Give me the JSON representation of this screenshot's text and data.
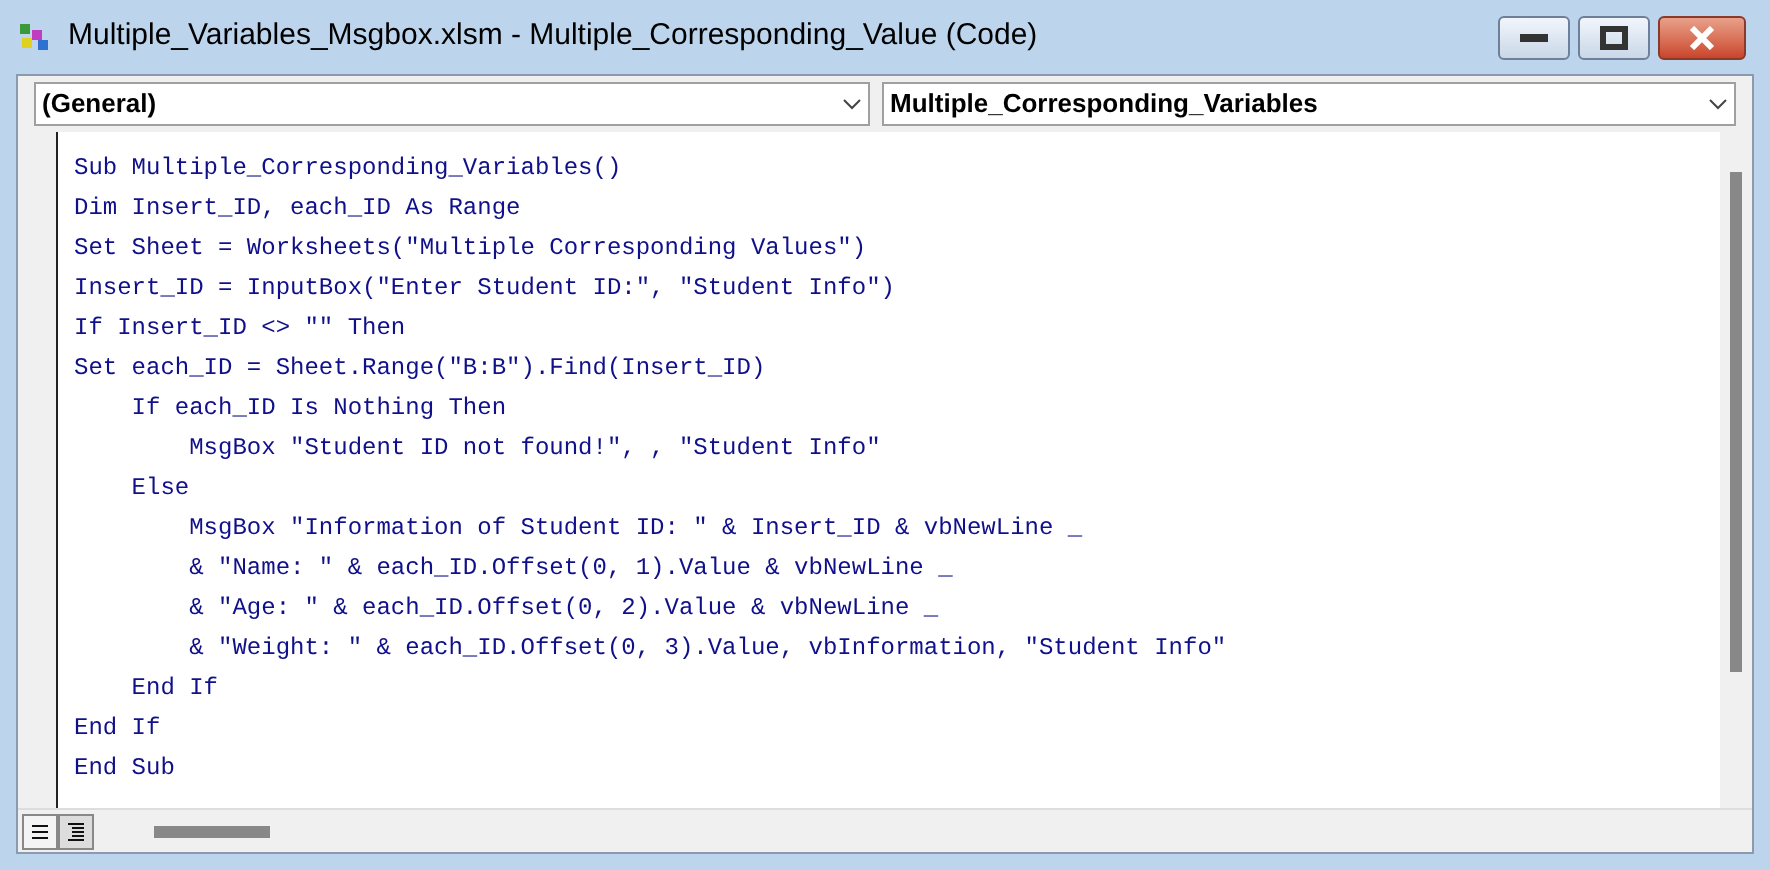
{
  "window": {
    "title": "Multiple_Variables_Msgbox.xlsm - Multiple_Corresponding_Value (Code)"
  },
  "object_box": {
    "value": "(General)"
  },
  "procedure_box": {
    "value": "Multiple_Corresponding_Variables"
  },
  "code_lines": [
    "Sub Multiple_Corresponding_Variables()",
    "Dim Insert_ID, each_ID As Range",
    "Set Sheet = Worksheets(\"Multiple Corresponding Values\")",
    "Insert_ID = InputBox(\"Enter Student ID:\", \"Student Info\")",
    "If Insert_ID <> \"\" Then",
    "Set each_ID = Sheet.Range(\"B:B\").Find(Insert_ID)",
    "    If each_ID Is Nothing Then",
    "        MsgBox \"Student ID not found!\", , \"Student Info\"",
    "    Else",
    "        MsgBox \"Information of Student ID: \" & Insert_ID & vbNewLine _",
    "        & \"Name: \" & each_ID.Offset(0, 1).Value & vbNewLine _",
    "        & \"Age: \" & each_ID.Offset(0, 2).Value & vbNewLine _",
    "        & \"Weight: \" & each_ID.Offset(0, 3).Value, vbInformation, \"Student Info\"",
    "    End If",
    "End If",
    "End Sub"
  ]
}
